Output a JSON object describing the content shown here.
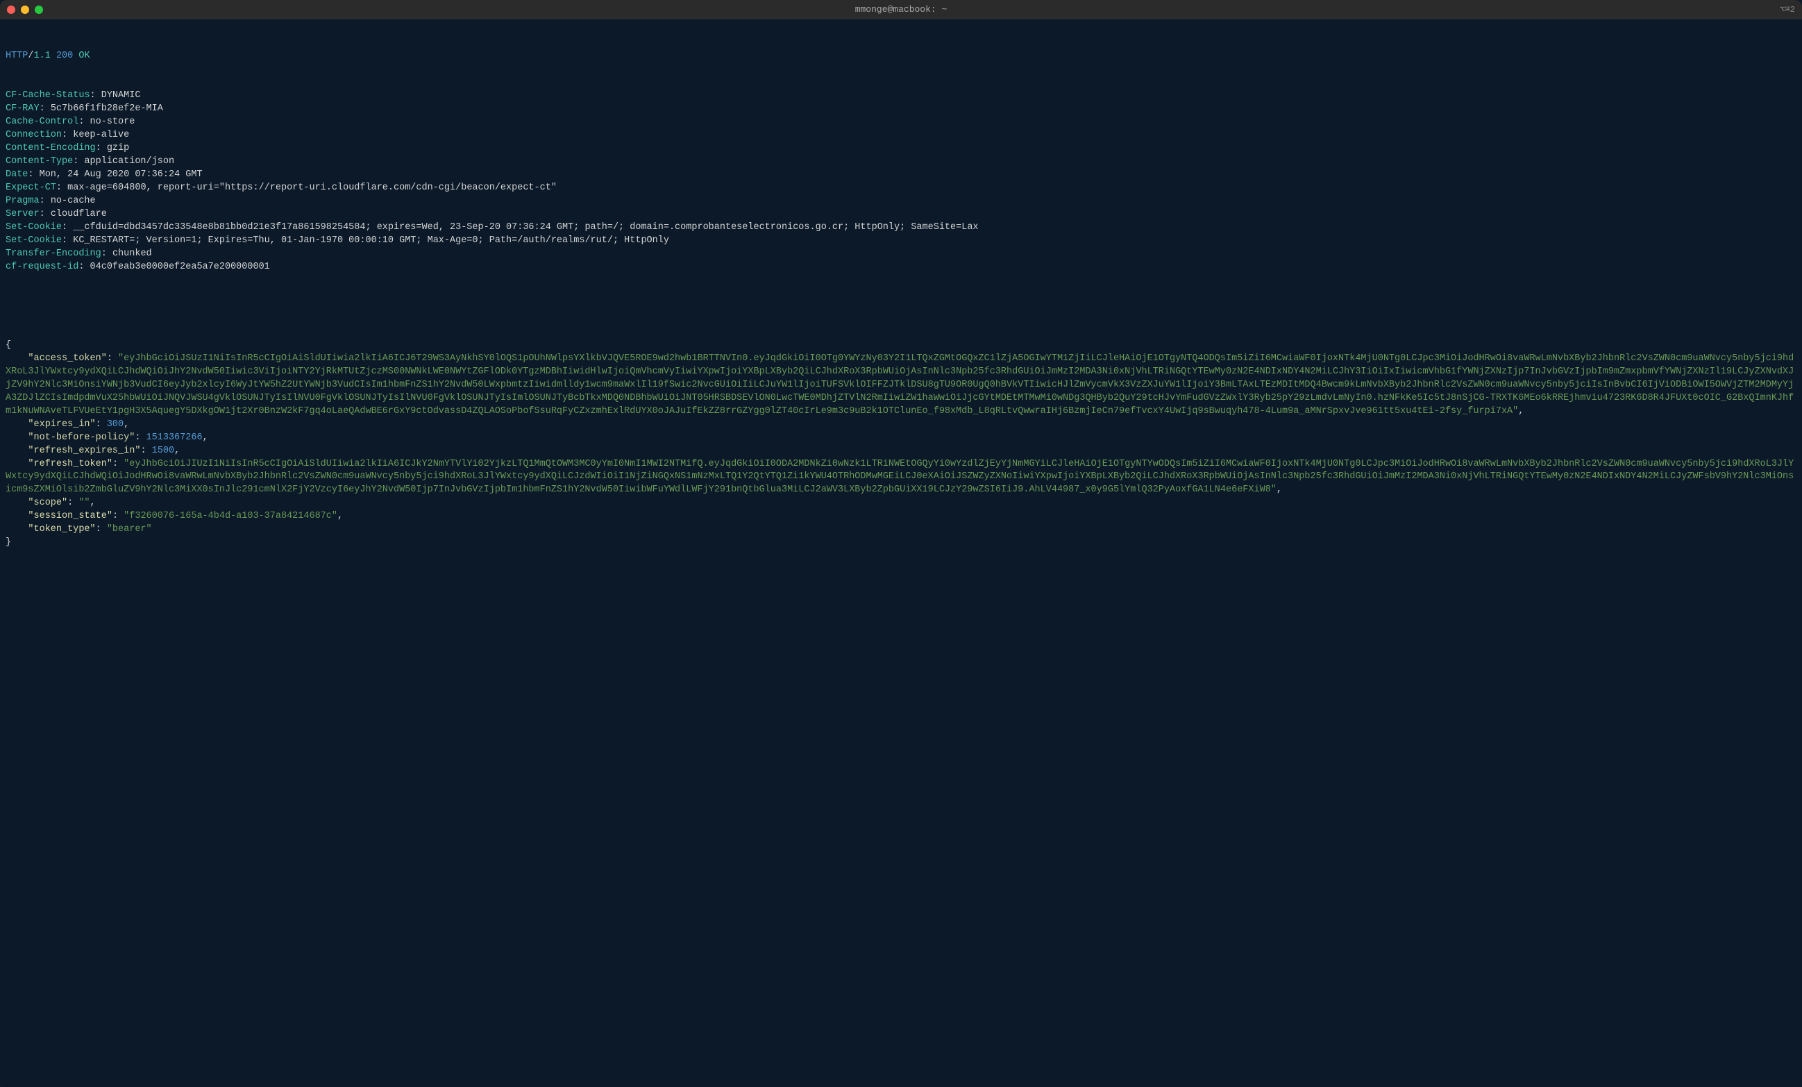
{
  "window": {
    "title": "mmonge@macbook: ~",
    "tab_indicator": "⌥⌘2"
  },
  "http": {
    "protocol": "HTTP",
    "version": "1.1",
    "status_code": "200",
    "status_text": "OK"
  },
  "headers": [
    {
      "name": "CF-Cache-Status",
      "value": "DYNAMIC"
    },
    {
      "name": "CF-RAY",
      "value": "5c7b66f1fb28ef2e-MIA"
    },
    {
      "name": "Cache-Control",
      "value": "no-store"
    },
    {
      "name": "Connection",
      "value": "keep-alive"
    },
    {
      "name": "Content-Encoding",
      "value": "gzip"
    },
    {
      "name": "Content-Type",
      "value": "application/json"
    },
    {
      "name": "Date",
      "value": "Mon, 24 Aug 2020 07:36:24 GMT"
    },
    {
      "name": "Expect-CT",
      "value": "max-age=604800, report-uri=\"https://report-uri.cloudflare.com/cdn-cgi/beacon/expect-ct\""
    },
    {
      "name": "Pragma",
      "value": "no-cache"
    },
    {
      "name": "Server",
      "value": "cloudflare"
    },
    {
      "name": "Set-Cookie",
      "value": "__cfduid=dbd3457dc33548e8b81bb0d21e3f17a861598254584; expires=Wed, 23-Sep-20 07:36:24 GMT; path=/; domain=.comprobanteselectronicos.go.cr; HttpOnly; SameSite=Lax"
    },
    {
      "name": "Set-Cookie",
      "value": "KC_RESTART=; Version=1; Expires=Thu, 01-Jan-1970 00:00:10 GMT; Max-Age=0; Path=/auth/realms/rut/; HttpOnly"
    },
    {
      "name": "Transfer-Encoding",
      "value": "chunked"
    },
    {
      "name": "cf-request-id",
      "value": "04c0feab3e0000ef2ea5a7e200000001"
    }
  ],
  "json_body": {
    "access_token": "eyJhbGciOiJSUzI1NiIsInR5cCIgOiAiSldUIiwia2lkIiA6ICJ6T29WS3AyNkhSY0lOQS1pOUhNWlpsYXlkbVJQVE5ROE9wd2hwb1BRTTNVIn0.eyJqdGkiOiI0OTg0YWYzNy03Y2I1LTQxZGMtOGQxZC1lZjA5OGIwYTM1ZjIiLCJleHAiOjE1OTgyNTQ4ODQsIm5iZiI6MCwiaWF0IjoxNTk4MjU0NTg0LCJpc3MiOiJodHRwOi8vaWRwLmNvbXByb2JhbnRlc2VsZWN0cm9uaWNvcy5nby5jci9hdXRoL3JlYWxtcy9ydXQiLCJhdWQiOiJhY2NvdW50Iiwic3ViIjoiNTY2YjRkMTUtZjczMS00NWNkLWE0NWYtZGFlODk0YTgzMDBhIiwidHlwIjoiQmVhcmVyIiwiYXpwIjoiYXBpLXByb2QiLCJhdXRoX3RpbWUiOjAsInNlc3Npb25fc3RhdGUiOiJmMzI2MDA3Ni0xNjVhLTRiNGQtYTEwMy0zN2E4NDIxNDY4N2MiLCJhY3IiOiIxIiwicmVhbG1fYWNjZXNzIjp7InJvbGVzIjpbIm9mZmxpbmVfYWNjZXNzIl19LCJyZXNvdXJjZV9hY2Nlc3MiOnsiYWNjb3VudCI6eyJyb2xlcyI6WyJtYW5hZ2UtYWNjb3VudCIsIm1hbmFnZS1hY2NvdW50LWxpbmtzIiwidmlldy1wcm9maWxlIl19fSwic2NvcGUiOiIiLCJuYW1lIjoiTUFSVklOIFFZJTklDSU8gTU9OR0UgQ0hBVkVTIiwicHJlZmVycmVkX3VzZXJuYW1lIjoiY3BmLTAxLTEzMDItMDQ4Bwcm9kLmNvbXByb2JhbnRlc2VsZWN0cm9uaWNvcy5nby5jciIsInBvbCI6IjViODBiOWI5OWVjZTM2MDMyYjA3ZDJlZCIsImdpdmVuX25hbWUiOiJNQVJWSU4gVklOSUNJTyIsIlNVU0FgVklOSUNJTyIsIlNVU0FgVklOSUNJTyIsImlOSUNJTyBcbTkxMDQ0NDBhbWUiOiJNT05HRSBDSEVlON0LwcTWE0MDhjZTVlN2RmIiwiZW1haWwiOiJjcGYtMDEtMTMwMi0wNDg3QHByb2QuY29tcHJvYmFudGVzZWxlY3Ryb25pY29zLmdvLmNyIn0.hzNFkKe5Ic5tJ8nSjCG-TRXTK6MEo6kRREjhmviu4723RK6D8R4JFUXt0cOIC_G2BxQImnKJhfm1kNuWNAveTLFVUeEtY1pgH3X5AquegY5DXkgOW1jt2Xr0BnzW2kF7gq4oLaeQAdwBE6rGxY9ctOdvassD4ZQLAOSoPbofSsuRqFyCZxzmhExlRdUYX0oJAJuIfEkZZ8rrGZYgg0lZT40cIrLe9m3c9uB2k1OTClunEo_f98xMdb_L8qRLtvQwwraIHj6BzmjIeCn79efTvcxY4UwIjq9sBwuqyh478-4Lum9a_aMNrSpxvJve961tt5xu4tEi-2fsy_furpi7xA",
    "expires_in": 300,
    "not-before-policy": 1513367266,
    "refresh_expires_in": 1500,
    "refresh_token": "eyJhbGciOiJIUzI1NiIsInR5cCIgOiAiSldUIiwia2lkIiA6ICJkY2NmYTVlYi02YjkzLTQ1MmQtOWM3MC0yYmI0NmI1MWI2NTMifQ.eyJqdGkiOiI0ODA2MDNkZi0wNzk1LTRiNWEtOGQyYi0wYzdlZjEyYjNmMGYiLCJleHAiOjE1OTgyNTYwODQsIm5iZiI6MCwiaWF0IjoxNTk4MjU0NTg0LCJpc3MiOiJodHRwOi8vaWRwLmNvbXByb2JhbnRlc2VsZWN0cm9uaWNvcy5nby5jci9hdXRoL3JlYWxtcy9ydXQiLCJhdWQiOiJodHRwOi8vaWRwLmNvbXByb2JhbnRlc2VsZWN0cm9uaWNvcy5nby5jci9hdXRoL3JlYWxtcy9ydXQiLCJzdWIiOiI1NjZiNGQxNS1mNzMxLTQ1Y2QtYTQ1Zi1kYWU4OTRhODMwMGEiLCJ0eXAiOiJSZWZyZXNoIiwiYXpwIjoiYXBpLXByb2QiLCJhdXRoX3RpbWUiOjAsInNlc3Npb25fc3RhdGUiOiJmMzI2MDA3Ni0xNjVhLTRiNGQtYTEwMy0zN2E4NDIxNDY4N2MiLCJyZWFsbV9hY2Nlc3MiOnsicm9sZXMiOlsib2ZmbGluZV9hY2Nlc3MiXX0sInJlc291cmNlX2FjY2VzcyI6eyJhY2NvdW50Ijp7InJvbGVzIjpbIm1hbmFnZS1hY2NvdW50IiwibWFuYWdlLWFjY291bnQtbGlua3MiLCJ2aWV3LXByb2ZpbGUiXX19LCJzY29wZSI6IiJ9.AhLV44987_x0y9G5lYmlQ32PyAoxfGA1LN4e6eFXiW8",
    "scope": "",
    "session_state": "f3260076-165a-4b4d-a103-37a84214687c",
    "token_type": "bearer"
  }
}
